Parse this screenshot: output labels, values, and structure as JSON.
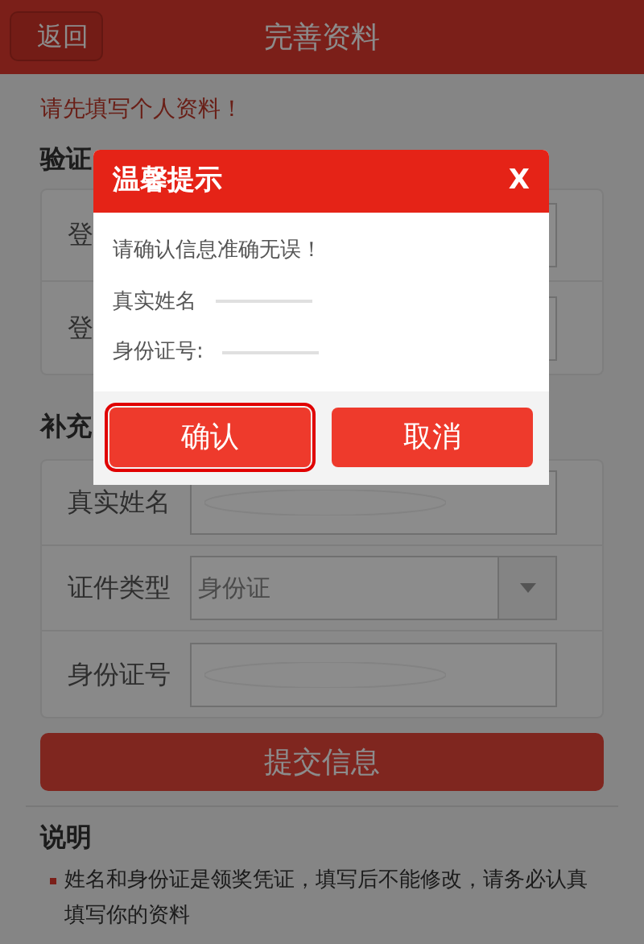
{
  "header": {
    "back": "返回",
    "title": "完善资料"
  },
  "notice": "请先填写个人资料！",
  "verify_section": {
    "title": "验证",
    "rows": [
      {
        "label": "登"
      },
      {
        "label": "登"
      }
    ]
  },
  "extra_section": {
    "title": "补充",
    "rows": [
      {
        "kind": "text",
        "label": "真实姓名",
        "redacted": true
      },
      {
        "kind": "select",
        "label": "证件类型",
        "value": "身份证"
      },
      {
        "kind": "text",
        "label": "身份证号",
        "redacted": true
      }
    ]
  },
  "submit": "提交信息",
  "notes": {
    "title": "说明",
    "items": [
      "姓名和身份证是领奖凭证，填写后不能修改，请务必认真填写你的资料"
    ]
  },
  "dialog": {
    "title": "温馨提示",
    "close": "X",
    "message": "请确认信息准确无误！",
    "fields": [
      {
        "label": "真实姓名"
      },
      {
        "label": "身份证号:"
      }
    ],
    "buttons": [
      {
        "label": "确认",
        "focused": true
      },
      {
        "label": "取消",
        "focused": false
      }
    ]
  }
}
